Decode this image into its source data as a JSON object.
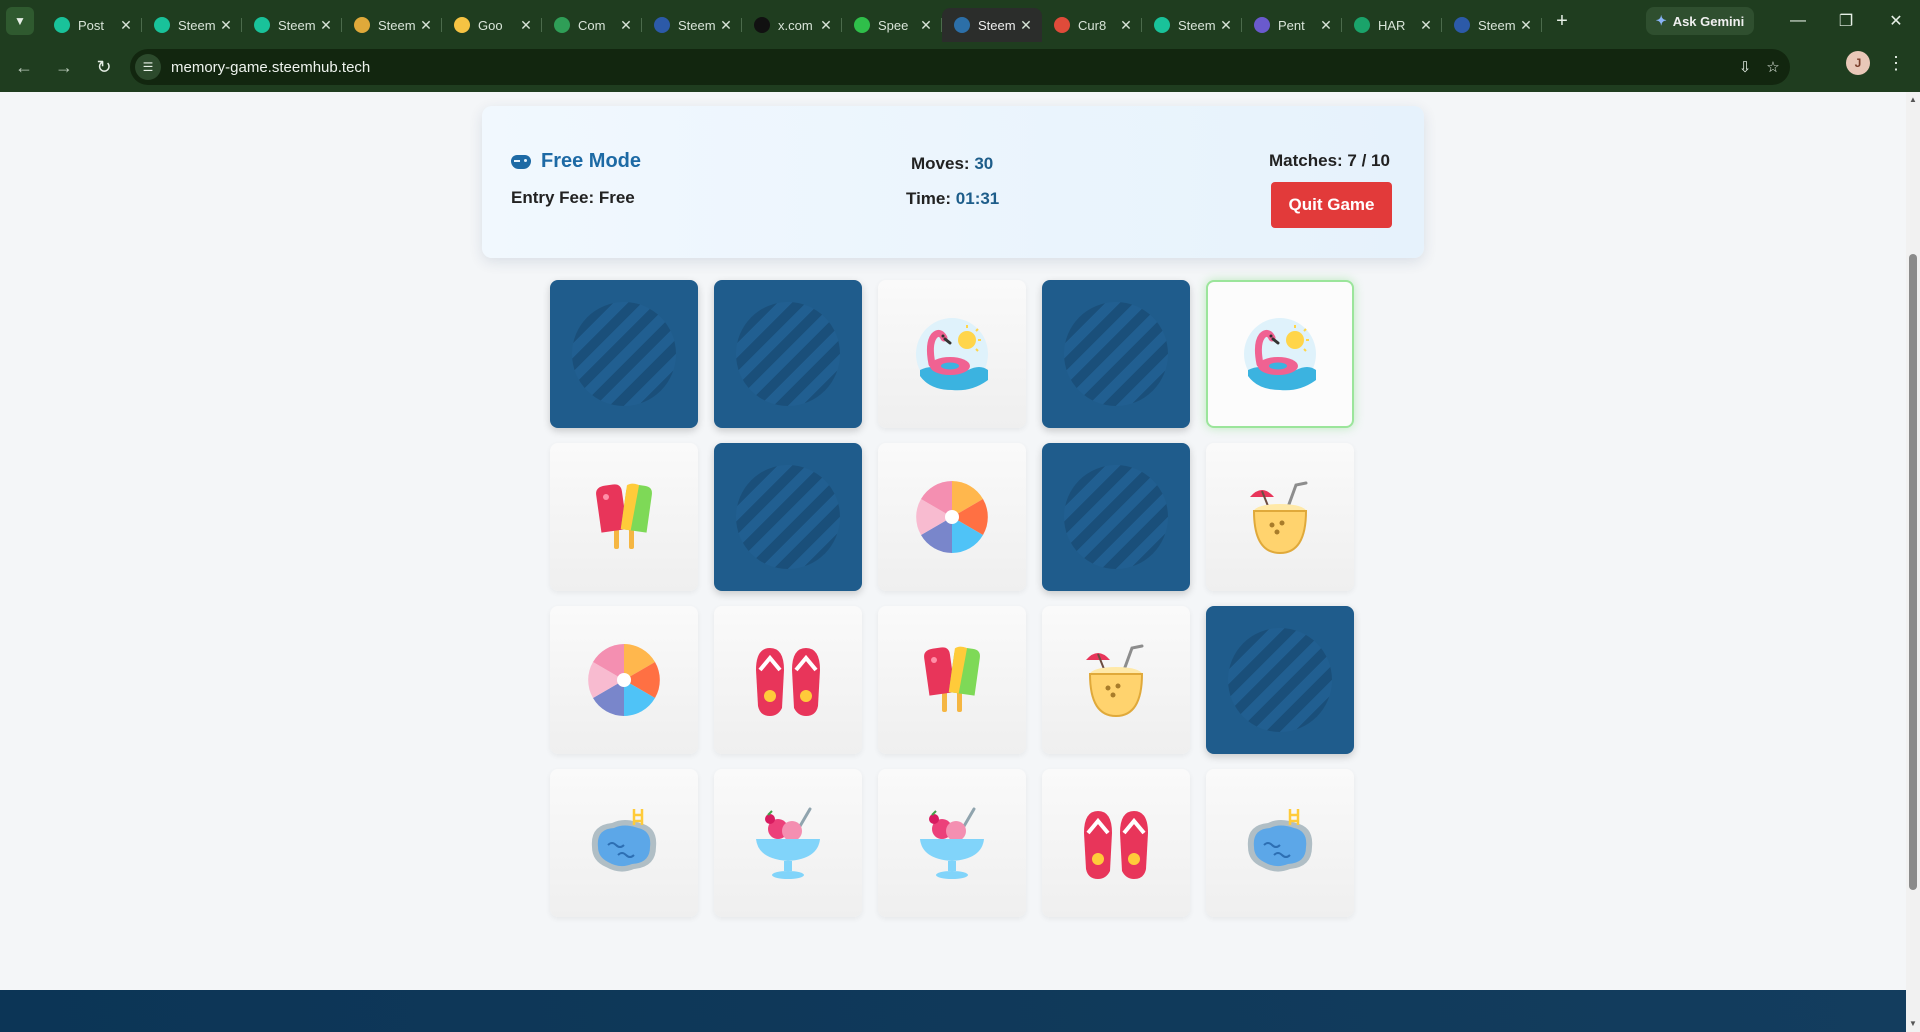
{
  "browser": {
    "tabs": [
      {
        "title": "Post",
        "favicon_color": "#19c29a",
        "active": false
      },
      {
        "title": "Steem",
        "favicon_color": "#19c29a",
        "active": false
      },
      {
        "title": "Steem",
        "favicon_color": "#19c29a",
        "active": false
      },
      {
        "title": "Steem",
        "favicon_color": "#e0a93a",
        "active": false
      },
      {
        "title": "Goo",
        "favicon_color": "#f6c343",
        "active": false
      },
      {
        "title": "Com",
        "favicon_color": "#2f9e57",
        "active": false
      },
      {
        "title": "Steem",
        "favicon_color": "#2c5aa8",
        "active": false
      },
      {
        "title": "x.com",
        "favicon_color": "#111111",
        "active": false
      },
      {
        "title": "Spee",
        "favicon_color": "#2fbf4a",
        "active": false
      },
      {
        "title": "Steem",
        "favicon_color": "#2c6fa8",
        "active": true
      },
      {
        "title": "Cur8",
        "favicon_color": "#e04b3a",
        "active": false
      },
      {
        "title": "Steem",
        "favicon_color": "#19c29a",
        "active": false
      },
      {
        "title": "Pent",
        "favicon_color": "#6a5acd",
        "active": false
      },
      {
        "title": "HAR",
        "favicon_color": "#1aa36a",
        "active": false
      },
      {
        "title": "Steem",
        "favicon_color": "#2c5aa8",
        "active": false
      }
    ],
    "ask_gemini_label": "Ask Gemini",
    "url": "memory-game.steemhub.tech",
    "profile_initial": "J"
  },
  "game": {
    "mode_label": "Free Mode",
    "entry_fee_label": "Entry Fee: Free",
    "moves_label": "Moves:",
    "moves_value": "30",
    "time_label": "Time:",
    "time_value": "01:31",
    "matches_label": "Matches: 7 / 10",
    "quit_label": "Quit Game"
  },
  "cards": [
    {
      "state": "down",
      "icon": null
    },
    {
      "state": "down",
      "icon": null
    },
    {
      "state": "up",
      "icon": "flamingo-float-icon"
    },
    {
      "state": "down",
      "icon": null
    },
    {
      "state": "active",
      "icon": "flamingo-float-icon"
    },
    {
      "state": "up",
      "icon": "popsicle-icon"
    },
    {
      "state": "down",
      "icon": null
    },
    {
      "state": "up",
      "icon": "beach-ball-icon"
    },
    {
      "state": "down",
      "icon": null
    },
    {
      "state": "up",
      "icon": "coconut-drink-icon"
    },
    {
      "state": "up",
      "icon": "beach-ball-icon"
    },
    {
      "state": "up",
      "icon": "flip-flops-icon"
    },
    {
      "state": "up",
      "icon": "popsicle-icon"
    },
    {
      "state": "up",
      "icon": "coconut-drink-icon"
    },
    {
      "state": "down",
      "icon": null
    },
    {
      "state": "up",
      "icon": "pool-icon"
    },
    {
      "state": "up",
      "icon": "ice-cream-sundae-icon"
    },
    {
      "state": "up",
      "icon": "ice-cream-sundae-icon"
    },
    {
      "state": "up",
      "icon": "flip-flops-icon"
    },
    {
      "state": "up",
      "icon": "pool-icon"
    }
  ],
  "colors": {
    "card_back": "#1f5c8c",
    "accent": "#1d6aa5",
    "quit_button": "#e23a3a",
    "match_highlight": "#9be59b"
  }
}
